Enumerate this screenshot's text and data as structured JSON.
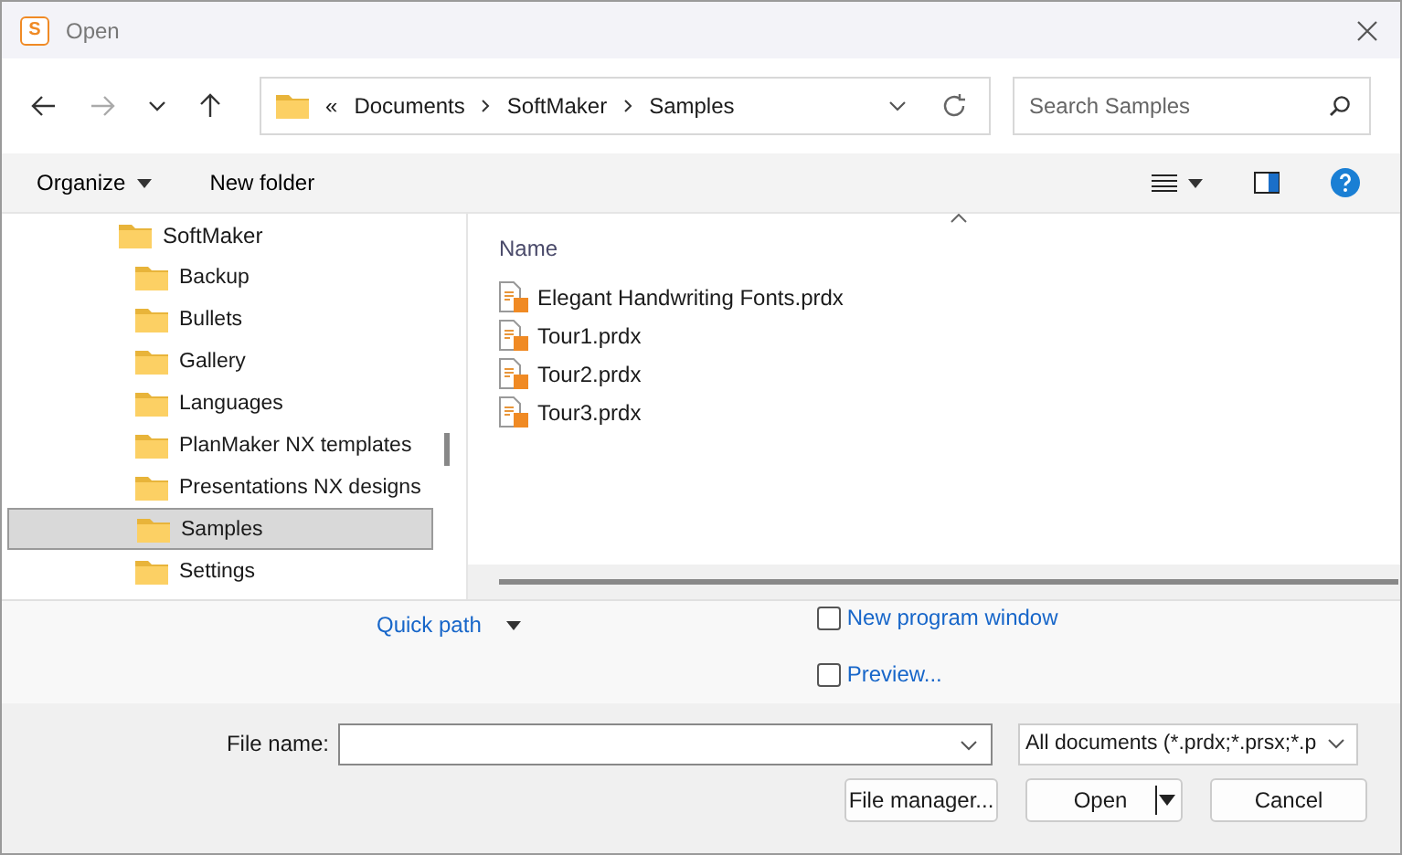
{
  "window": {
    "title": "Open"
  },
  "app_icon": "S",
  "breadcrumb": {
    "overflow": "«",
    "parts": [
      "Documents",
      "SoftMaker",
      "Samples"
    ]
  },
  "search": {
    "placeholder": "Search Samples"
  },
  "toolbar": {
    "organize": "Organize",
    "new_folder": "New folder"
  },
  "tree": [
    {
      "label": "SoftMaker",
      "selected": false,
      "children": [
        {
          "label": "Backup",
          "selected": false
        },
        {
          "label": "Bullets",
          "selected": false
        },
        {
          "label": "Gallery",
          "selected": false
        },
        {
          "label": "Languages",
          "selected": false
        },
        {
          "label": "PlanMaker NX templates",
          "selected": false
        },
        {
          "label": "Presentations NX designs",
          "selected": false
        },
        {
          "label": "Samples",
          "selected": true
        },
        {
          "label": "Settings",
          "selected": false
        }
      ]
    }
  ],
  "files": {
    "column": "Name",
    "items": [
      "Elegant Handwriting Fonts.prdx",
      "Tour1.prdx",
      "Tour2.prdx",
      "Tour3.prdx"
    ]
  },
  "quick_path": "Quick path",
  "options": [
    {
      "label": "New program window",
      "checked": false
    },
    {
      "label": "Preview...",
      "checked": false
    }
  ],
  "file_name": {
    "label": "File name:"
  },
  "file_type": {
    "value": "All documents (*.prdx;*.prsx;*.p"
  },
  "buttons": {
    "file_manager": "File manager...",
    "open": "Open",
    "cancel": "Cancel"
  }
}
